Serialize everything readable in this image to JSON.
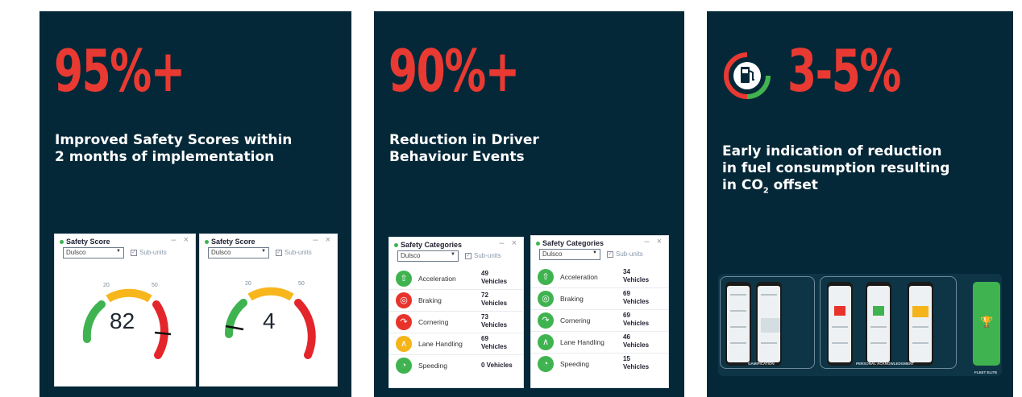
{
  "cards": [
    {
      "stat": "95%+",
      "desc_lines": [
        "Improved Safety Scores within",
        "2 months of implementation"
      ],
      "widgets": [
        {
          "title": "Safety Score",
          "select": "Dulsco",
          "subunits": "Sub-units",
          "min_label": "20",
          "max_label": "50",
          "value": "82"
        },
        {
          "title": "Safety Score",
          "select": "Dulsco",
          "subunits": "Sub-units",
          "min_label": "20",
          "max_label": "50",
          "value": "4"
        }
      ]
    },
    {
      "stat": "90%+",
      "desc_lines": [
        "Reduction in Driver",
        "Behaviour Events"
      ],
      "widgets": [
        {
          "title": "Safety Categories",
          "select": "Dulsco",
          "subunits": "Sub-units",
          "rows": [
            {
              "name": "Acceleration",
              "value": "49 Vehicles"
            },
            {
              "name": "Braking",
              "value": "72 Vehicles"
            },
            {
              "name": "Cornering",
              "value": "73 Vehicles"
            },
            {
              "name": "Lane Handling",
              "value": "69 Vehicles"
            },
            {
              "name": "Speeding",
              "value": "0 Vehicles"
            }
          ]
        },
        {
          "title": "Safety Categories",
          "select": "Dulsco",
          "subunits": "Sub-units",
          "rows": [
            {
              "name": "Acceleration",
              "value": "34 Vehicles"
            },
            {
              "name": "Braking",
              "value": "69 Vehicles"
            },
            {
              "name": "Cornering",
              "value": "69 Vehicles"
            },
            {
              "name": "Lane Handling",
              "value": "46 Vehicles"
            },
            {
              "name": "Speeding",
              "value": "15 Vehicles"
            }
          ]
        }
      ]
    },
    {
      "stat": "3-5%",
      "desc_lines": [
        "Early indication of reduction",
        "in fuel consumption resulting"
      ],
      "desc_last_prefix": "in CO",
      "desc_last_sub": "2",
      "desc_last_suffix": " offset",
      "strip_labels": [
        "GAMIFICATION",
        "PERSONAL ACKNOWLEDGMENT",
        "FLEET ELITE"
      ]
    }
  ],
  "icons": {
    "category_icons": [
      "arrow-up-icon",
      "brake-icon",
      "turn-icon",
      "lane-icon",
      "speed-icon"
    ],
    "category_colors": [
      "#3fb34f",
      "#e8332b",
      "#e8332b",
      "#f4b41a",
      "#3fb34f"
    ]
  },
  "colors": {
    "card_bg": "#052838",
    "accent_red": "#e83a32",
    "green": "#3fb34f",
    "amber": "#f7b61c"
  }
}
